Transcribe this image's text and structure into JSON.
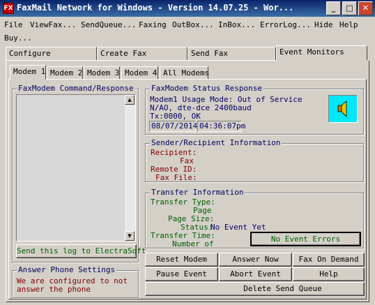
{
  "window": {
    "title": "FaxMail Network for Windows - Version 14.07.25 - Wor...",
    "icon_label": "FX",
    "buttons": {
      "minimize": "_",
      "maximize": "□",
      "close": "✕"
    }
  },
  "menu": {
    "row1": [
      "File",
      "ViewFax...",
      "SendQueue...",
      "Faxing",
      "OutBox...",
      "InBox...",
      "ErrorLog...",
      "Hide",
      "Help"
    ],
    "row2": [
      "Buy..."
    ]
  },
  "tabs": [
    "Configure",
    "Create Fax",
    "Send Fax",
    "Event Monitors"
  ],
  "modem_tabs": [
    "Modem 1",
    "Modem 2",
    "Modem 3",
    "Modem 4",
    "All Modems"
  ],
  "command_response": {
    "title": "FaxModem Command/Response",
    "log_button": "Send this log to ElectraSoft"
  },
  "answer_phone": {
    "title": "Answer Phone Settings",
    "text_line1": "We are configured to not",
    "text_line2": "answer the phone"
  },
  "status": {
    "title": "FaxModem Status Response",
    "line1": "Modem1 Usage Mode: Out of Service",
    "line2": "N/AO, dte-dce 2400baud",
    "line3": "Tx:0000,        OK",
    "date": "08/07/2014",
    "time": "04:36:07pm",
    "icon": "speaker-icon"
  },
  "sender": {
    "title": "Sender/Recipient Information",
    "recipient": "Recipient:",
    "fax": "Fax",
    "remote_id": "Remote ID:",
    "fax_file": "Fax File:"
  },
  "transfer": {
    "title": "Transfer Information",
    "type": "Transfer Type:",
    "page": "Page",
    "page_size": "Page Size:",
    "status_label": "Status:",
    "status_value": "No Event Yet",
    "time": "Transfer Time:",
    "number_of": "Number of",
    "errors_button": "No Event Errors"
  },
  "actions": {
    "reset_modem": "Reset Modem",
    "answer_now": "Answer Now",
    "fax_on_demand": "Fax On Demand",
    "pause_event": "Pause Event",
    "abort_event": "Abort Event",
    "help": "Help",
    "delete_send_queue": "Delete Send Queue"
  },
  "colors": {
    "title_bar": "#0a246a",
    "group_title": "#000060",
    "field_label": "#006000",
    "speaker_bg": "#00e8f8",
    "log_area": "#d8d8d8"
  }
}
